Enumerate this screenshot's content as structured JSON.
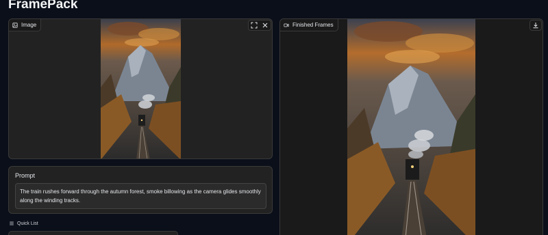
{
  "app": {
    "title": "FramePack"
  },
  "image_panel": {
    "label": "Image",
    "icon": "image-icon",
    "fullscreen_icon": "fullscreen-icon",
    "clear_icon": "close-icon"
  },
  "frames_panel": {
    "label": "Finished Frames",
    "icon": "video-icon",
    "download_icon": "download-icon"
  },
  "prompt": {
    "label": "Prompt",
    "value": "The train rushes forward through the autumn forest, smoke billowing as the camera glides smoothly along the winding tracks."
  },
  "quick_list": {
    "label": "Quick List",
    "icon": "list-icon"
  },
  "colors": {
    "background": "#0b0f19",
    "panel": "#222222",
    "border": "#3a3a3a",
    "text": "#e5e7eb"
  }
}
